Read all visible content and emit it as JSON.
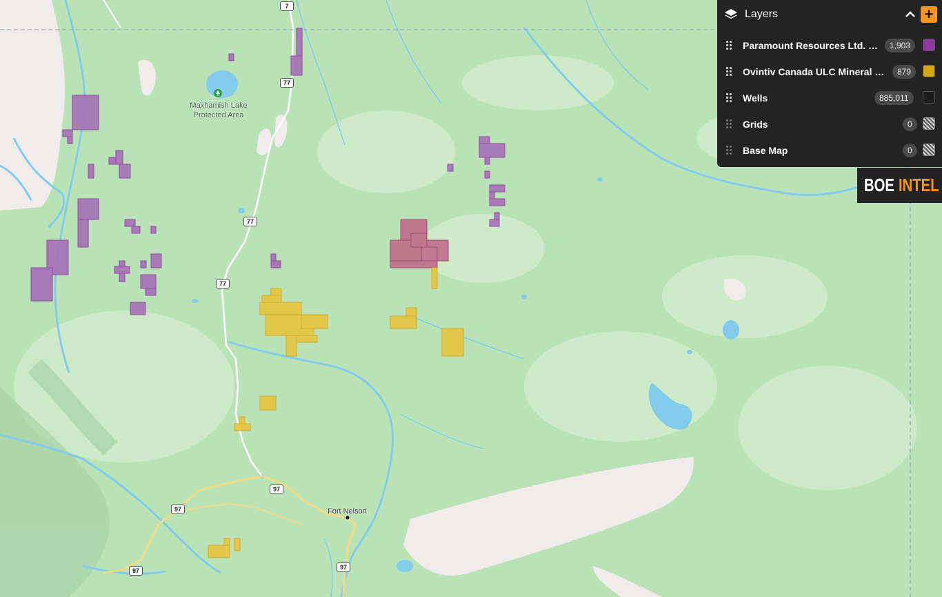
{
  "map": {
    "colors": {
      "land": "#b9e3b7",
      "land_light": "#cdebc9",
      "water": "#82cbea",
      "ice": "#f1ecec",
      "road": "#ffffff",
      "highway": "#f0da84",
      "paramount_fill": "#a671b6",
      "ovintiv_fill": "#e8c43c"
    },
    "road_shields": [
      "7",
      "77",
      "77",
      "77",
      "97",
      "97",
      "97",
      "97"
    ],
    "places": {
      "lake_name": "Maxhamish Lake",
      "area_name": "Protected Area",
      "town": "Fort Nelson"
    },
    "park_icon": "tree-icon"
  },
  "layers_panel": {
    "title": "Layers",
    "icon": "layers-stack-icon",
    "collapse_icon": "chevron-up-icon",
    "add_icon": "plus-icon",
    "add_label": "+",
    "accent": "#f7941d",
    "items": [
      {
        "label": "Paramount Resources Ltd. Mi...",
        "count": "1,903",
        "color": "#8e3aa0",
        "swatch": "solid"
      },
      {
        "label": "Ovintiv Canada ULC Mineral Rig...",
        "count": "879",
        "color": "#d7a613",
        "swatch": "solid"
      },
      {
        "label": "Wells",
        "count": "885,011",
        "color": "#1c1c1c",
        "swatch": "solid"
      },
      {
        "label": "Grids",
        "count": "0",
        "color": "#cccccc",
        "swatch": "hatch"
      },
      {
        "label": "Base Map",
        "count": "0",
        "color": "#cccccc",
        "swatch": "hatch"
      }
    ]
  },
  "logo": {
    "part1": "BOE",
    "part2": "INTEL"
  }
}
